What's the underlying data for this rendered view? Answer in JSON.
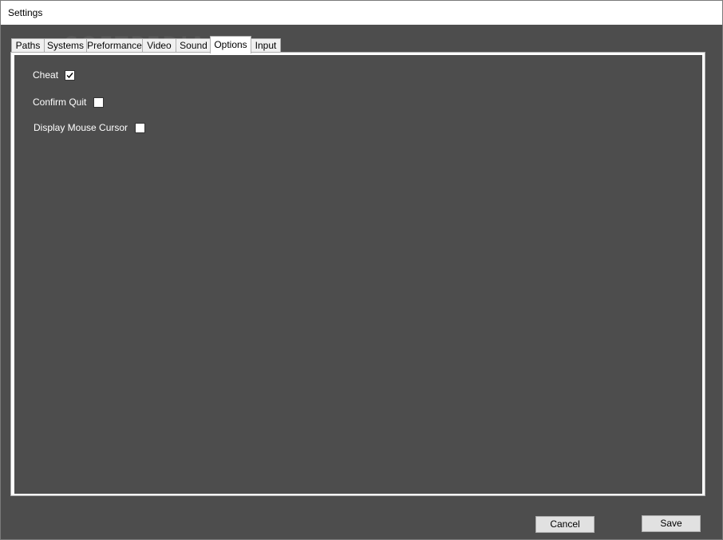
{
  "window": {
    "title": "Settings"
  },
  "tabs": [
    {
      "label": "Paths",
      "selected": false
    },
    {
      "label": "Systems",
      "selected": false
    },
    {
      "label": "Preformance",
      "selected": false
    },
    {
      "label": "Video",
      "selected": false
    },
    {
      "label": "Sound",
      "selected": false
    },
    {
      "label": "Options",
      "selected": true
    },
    {
      "label": "Input",
      "selected": false
    }
  ],
  "options": [
    {
      "label": "Cheat",
      "checked": true
    },
    {
      "label": "Confirm Quit",
      "checked": false
    },
    {
      "label": "Display Mouse Cursor",
      "checked": false
    }
  ],
  "buttons": {
    "cancel_label": "Cancel",
    "save_label": "Save"
  },
  "watermark": "SOFTPEDIA",
  "colors": {
    "background": "#4d4d4d",
    "tab_page_border": "#ffffff",
    "text": "#ffffff"
  }
}
